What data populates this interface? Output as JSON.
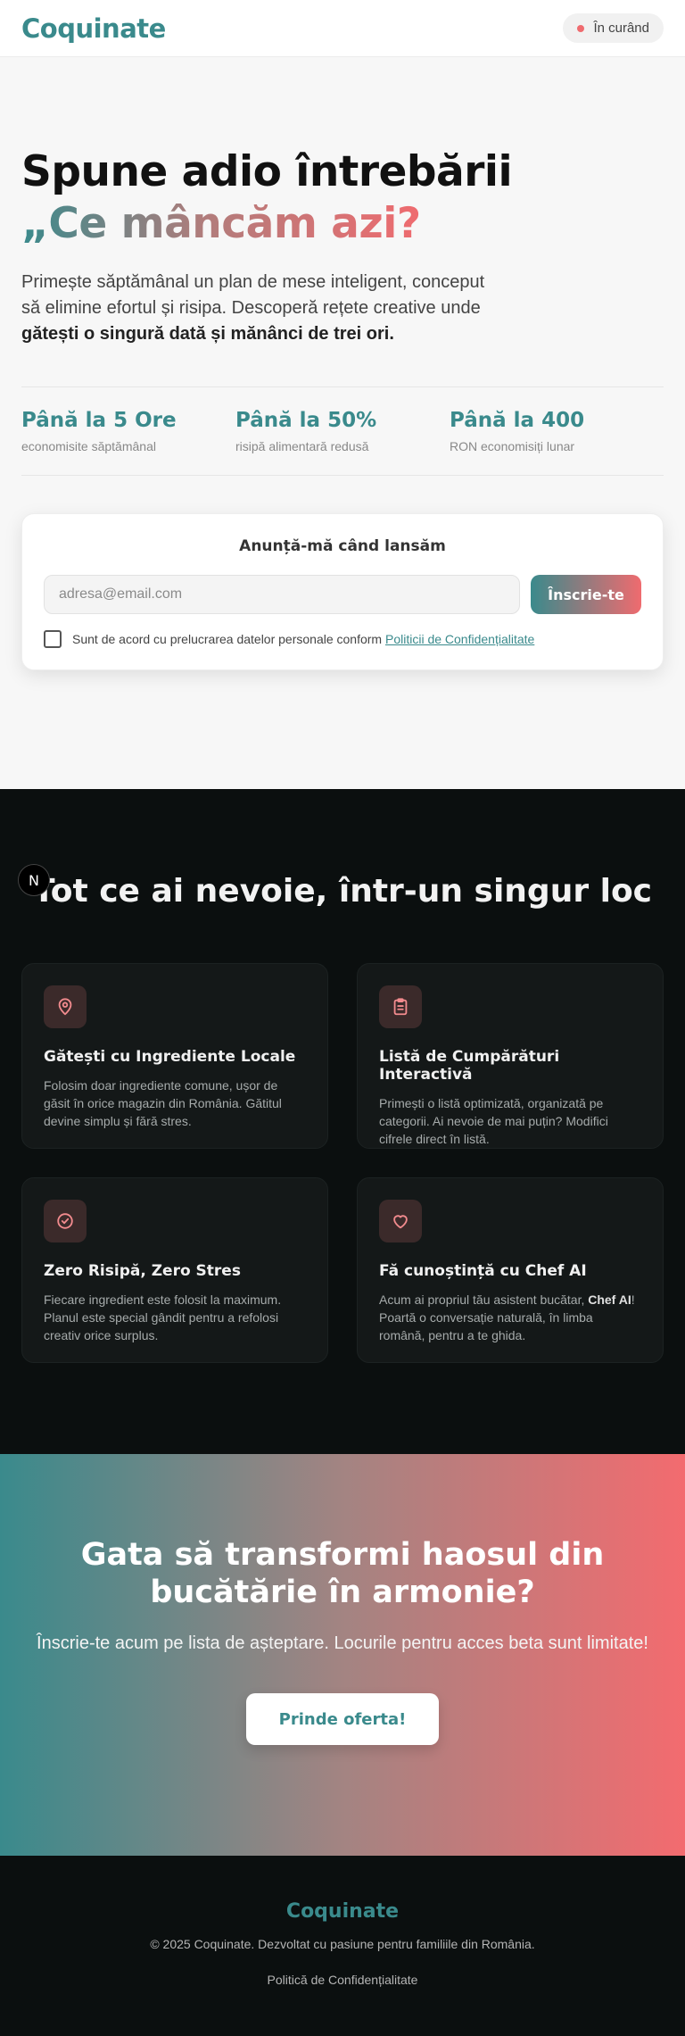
{
  "header": {
    "logo": "Coquinate",
    "status": "În curând",
    "status_color": "#ef6b6f"
  },
  "hero": {
    "title_line1": "Spune adio întrebării",
    "title_line2": "„Ce mâncăm azi?",
    "desc_part1": "Primește săptămânal un plan de mese inteligent, conceput să elimine efortul și risipa. Descoperă rețete creative unde ",
    "desc_bold": "gătești o singură dată și mănânci de trei ori.",
    "stats": [
      {
        "value": "Până la 5 Ore",
        "label": "economisite săptămânal"
      },
      {
        "value": "Până la 50%",
        "label": "risipă alimentară redusă"
      },
      {
        "value": "Până la 400",
        "label": "RON economisiți lunar"
      }
    ]
  },
  "signup": {
    "title": "Anunță-mă când lansăm",
    "email_placeholder": "adresa@email.com",
    "button": "Înscrie-te",
    "consent_text": "Sunt de acord cu prelucrarea datelor personale conform ",
    "consent_link": "Politicii de Confidențialitate"
  },
  "features": {
    "badge": "N",
    "title": "Tot ce ai nevoie, într-un singur loc",
    "items": [
      {
        "icon": "map-pin-icon",
        "title": "Gătești cu Ingrediente Locale",
        "desc": "Folosim doar ingrediente comune, ușor de găsit în orice magazin din România. Gătitul devine simplu și fără stres."
      },
      {
        "icon": "clipboard-list-icon",
        "title": "Listă de Cumpărături Interactivă",
        "desc": "Primești o listă optimizată, organizată pe categorii. Ai nevoie de mai puțin? Modifici cifrele direct în listă."
      },
      {
        "icon": "check-circle-icon",
        "title": "Zero Risipă, Zero Stres",
        "desc": "Fiecare ingredient este folosit la maximum. Planul este special gândit pentru a refolosi creativ orice surplus."
      },
      {
        "icon": "heart-icon",
        "title": "Fă cunoștință cu Chef AI",
        "desc_part1": "Acum ai propriul tău asistent bucătar, ",
        "desc_bold": "Chef AI",
        "desc_part2": "! Poartă o conversație naturală, în limba română, pentru a te ghida."
      }
    ]
  },
  "cta": {
    "title": "Gata să transformi haosul din bucătărie în armonie?",
    "desc": "Înscrie-te acum pe lista de așteptare. Locurile pentru acces beta sunt limitate!",
    "button": "Prinde oferta!"
  },
  "footer": {
    "logo": "Coquinate",
    "copyright": "© 2025 Coquinate. Dezvoltat cu pasiune pentru familiile din România.",
    "privacy_link": "Politică de Confidențialitate"
  },
  "colors": {
    "teal": "#3a8a8c",
    "coral": "#ef6b6f",
    "dark": "#0b0f0f"
  }
}
